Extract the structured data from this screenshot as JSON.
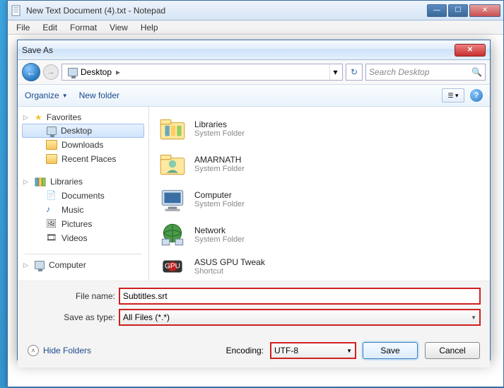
{
  "notepad": {
    "title": "New Text Document (4).txt - Notepad",
    "menu": {
      "file": "File",
      "edit": "Edit",
      "format": "Format",
      "view": "View",
      "help": "Help"
    }
  },
  "dialog": {
    "title": "Save As",
    "nav": {
      "location": "Desktop",
      "arrow": "▸",
      "search_placeholder": "Search Desktop"
    },
    "toolbar": {
      "organize": "Organize",
      "newfolder": "New folder"
    },
    "sidebar": {
      "favorites": {
        "label": "Favorites",
        "items": [
          "Desktop",
          "Downloads",
          "Recent Places"
        ]
      },
      "libraries": {
        "label": "Libraries",
        "items": [
          "Documents",
          "Music",
          "Pictures",
          "Videos"
        ]
      },
      "computer": {
        "label": "Computer"
      }
    },
    "main": {
      "items": [
        {
          "name": "Libraries",
          "sub": "System Folder"
        },
        {
          "name": "AMARNATH",
          "sub": "System Folder"
        },
        {
          "name": "Computer",
          "sub": "System Folder"
        },
        {
          "name": "Network",
          "sub": "System Folder"
        },
        {
          "name": "ASUS GPU Tweak",
          "sub": "Shortcut"
        }
      ]
    },
    "form": {
      "filename_label": "File name:",
      "filename_value": "Subtitles.srt",
      "type_label": "Save as type:",
      "type_value": "All Files  (*.*)"
    },
    "bottom": {
      "hide_folders": "Hide Folders",
      "encoding_label": "Encoding:",
      "encoding_value": "UTF-8",
      "save": "Save",
      "cancel": "Cancel"
    }
  }
}
